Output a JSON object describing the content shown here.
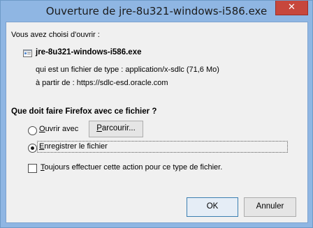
{
  "window": {
    "title": "Ouverture de jre-8u321-windows-i586.exe",
    "close_symbol": "✕"
  },
  "dialog": {
    "intro": "Vous avez choisi d'ouvrir :",
    "file_name": "jre-8u321-windows-i586.exe",
    "file_type": "qui est un fichier de type :  application/x-sdlc (71,6 Mo)",
    "file_source": "à partir de :  https://sdlc-esd.oracle.com",
    "question": "Que doit faire Firefox avec ce fichier ?",
    "options": [
      {
        "label_key": "O",
        "label_rest": "uvrir avec",
        "selected": false
      },
      {
        "label_key": "E",
        "label_rest": "nregistrer le fichier",
        "selected": true
      }
    ],
    "browse_button": {
      "key": "P",
      "rest": "arcourir..."
    },
    "always_checkbox": {
      "key": "T",
      "rest": "oujours effectuer cette action pour ce type de fichier.",
      "checked": false
    },
    "ok_button": "OK",
    "cancel_button": "Annuler"
  },
  "icons": {
    "file": "application-file-icon",
    "close": "close-icon"
  },
  "colors": {
    "titlebar": "#8fb6e3",
    "close": "#c7473c",
    "dialog_bg": "#f0f0f0"
  }
}
